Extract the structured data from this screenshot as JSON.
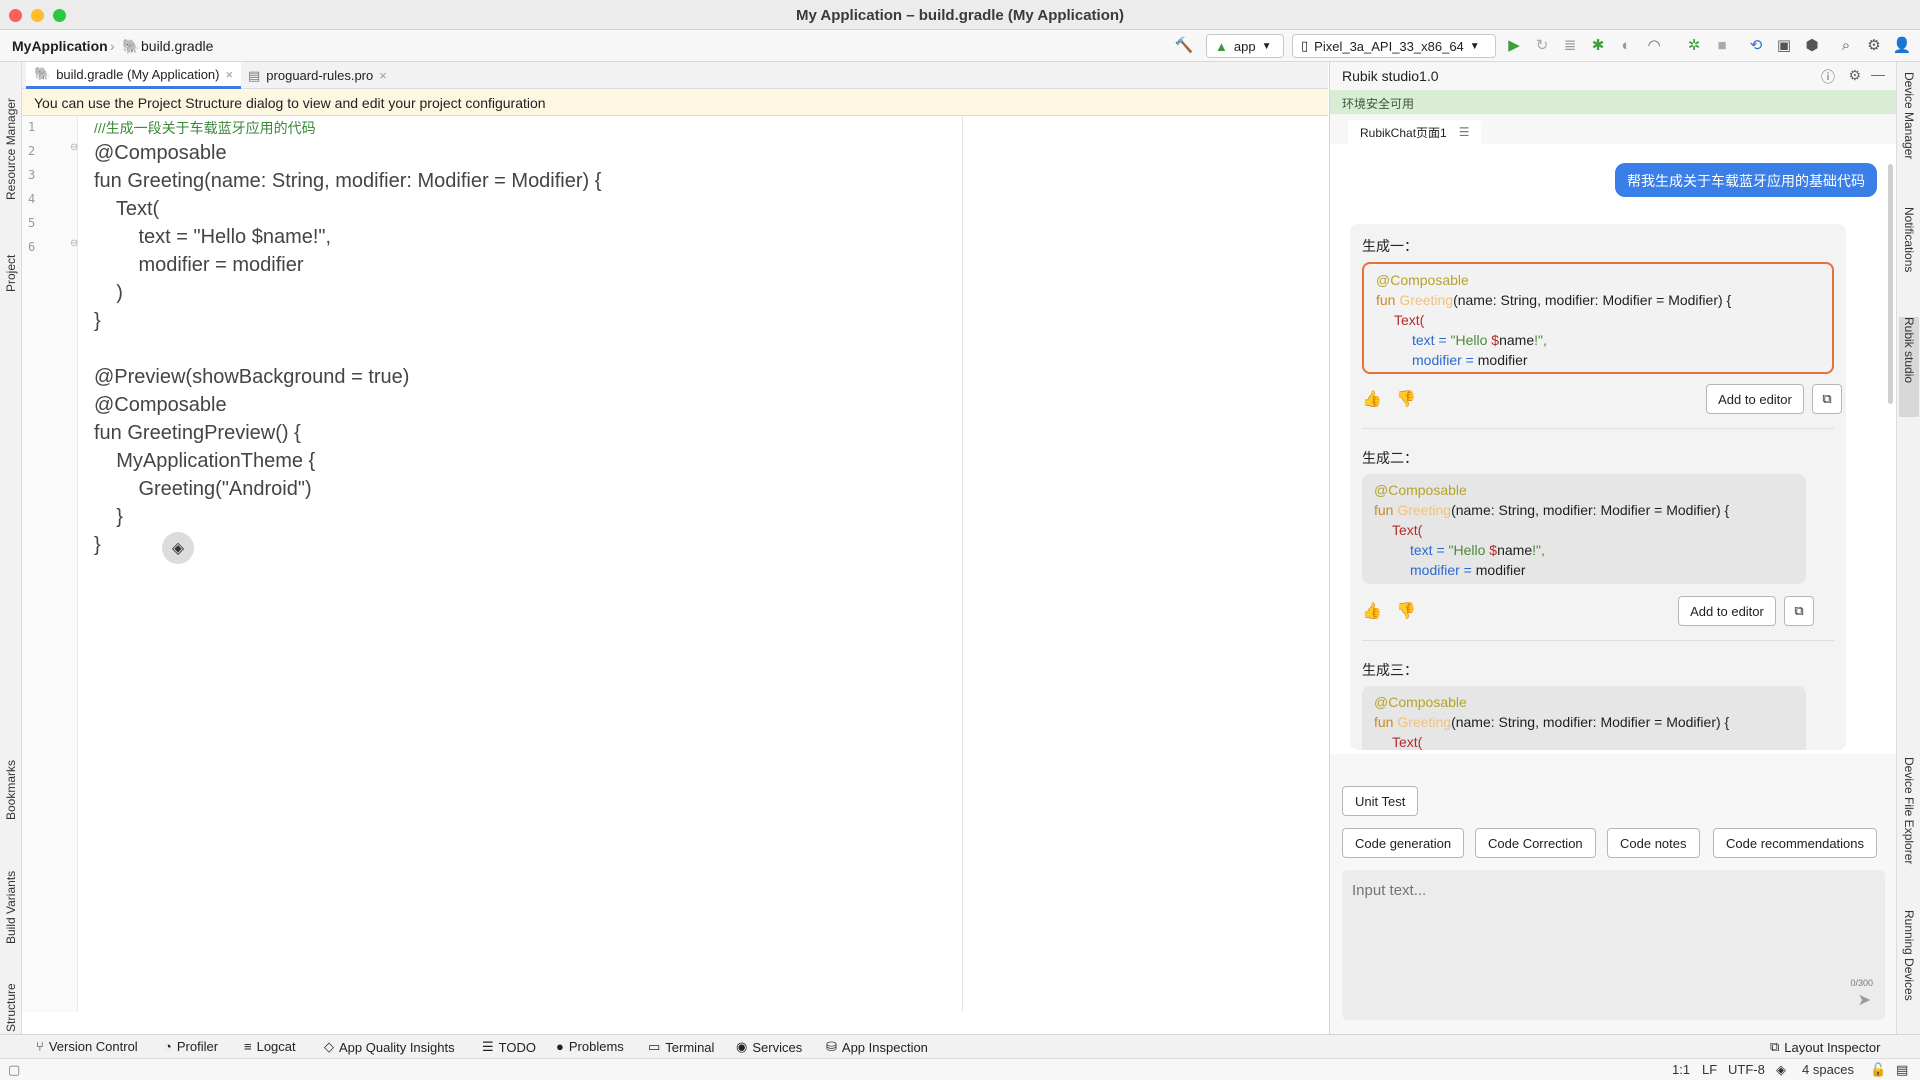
{
  "window": {
    "title": "My Application – build.gradle (My Application)"
  },
  "colors": {
    "close": "#fe5f57",
    "minimize": "#febc2e",
    "maximize": "#28c840",
    "accent": "#3a7ee8",
    "highlight": "#e8703a"
  },
  "nav": {
    "project": "MyApplication",
    "file": "build.gradle",
    "run_config": "app",
    "device": "Pixel_3a_API_33_x86_64"
  },
  "left_tools": {
    "resource_manager": "Resource Manager",
    "project": "Project",
    "bookmarks": "Bookmarks",
    "build_variants": "Build Variants",
    "structure": "Structure"
  },
  "right_tools": {
    "device_manager": "Device Manager",
    "notifications": "Notifications",
    "rubik": "Rubik studio",
    "device_file_explorer": "Device File Explorer",
    "running_devices": "Running Devices"
  },
  "editor": {
    "tabs": [
      {
        "label": "build.gradle (My Application)"
      },
      {
        "label": "proguard-rules.pro"
      }
    ],
    "banner": "You can use the Project Structure dialog to view and edit your project configuration",
    "line_numbers": [
      "1",
      "2",
      "3",
      "4",
      "5",
      "6"
    ],
    "lines": [
      "///生成一段关于车载蓝牙应用的代码",
      "@Composable",
      "fun Greeting(name: String, modifier: Modifier = Modifier) {",
      "    Text(",
      "        text = \"Hello $name!\",",
      "        modifier = modifier",
      "    )",
      "}",
      "",
      "@Preview(showBackground = true)",
      "@Composable",
      "fun GreetingPreview() {",
      "    MyApplicationTheme {",
      "        Greeting(\"Android\")",
      "    }",
      "}"
    ]
  },
  "panel": {
    "title": "Rubik studio1.0",
    "env_status": "环境安全可用",
    "chat_tab": "RubikChat页面1",
    "user_message": "帮我生成关于车载蓝牙应用的基础代码",
    "answers": [
      {
        "title": "生成一：",
        "add_label": "Add to editor"
      },
      {
        "title": "生成二：",
        "add_label": "Add to editor"
      },
      {
        "title": "生成三："
      }
    ],
    "code": {
      "ann": "@Composable",
      "fun": "fun ",
      "name": "Greeting",
      "sig": "(name: String, modifier: Modifier = Modifier) {",
      "text": "Text(",
      "p_text": "text = ",
      "str1": "\"Hello ",
      "dollar": "$",
      "str2": "name",
      "str3": "!\",",
      "p_mod": "modifier = ",
      "mod": "modifier"
    },
    "quick_actions": [
      "Unit Test",
      "Code generation",
      "Code Correction",
      "Code notes",
      "Code recommendations"
    ],
    "input": {
      "placeholder": "Input text...",
      "counter": "0/300"
    }
  },
  "bottom_tools": [
    "Version Control",
    "Profiler",
    "Logcat",
    "App Quality Insights",
    "TODO",
    "Problems",
    "Terminal",
    "Services",
    "App Inspection"
  ],
  "layout_inspector": "Layout Inspector",
  "status": {
    "position": "1:1",
    "line_sep": "LF",
    "encoding": "UTF-8",
    "indent": "4 spaces"
  }
}
